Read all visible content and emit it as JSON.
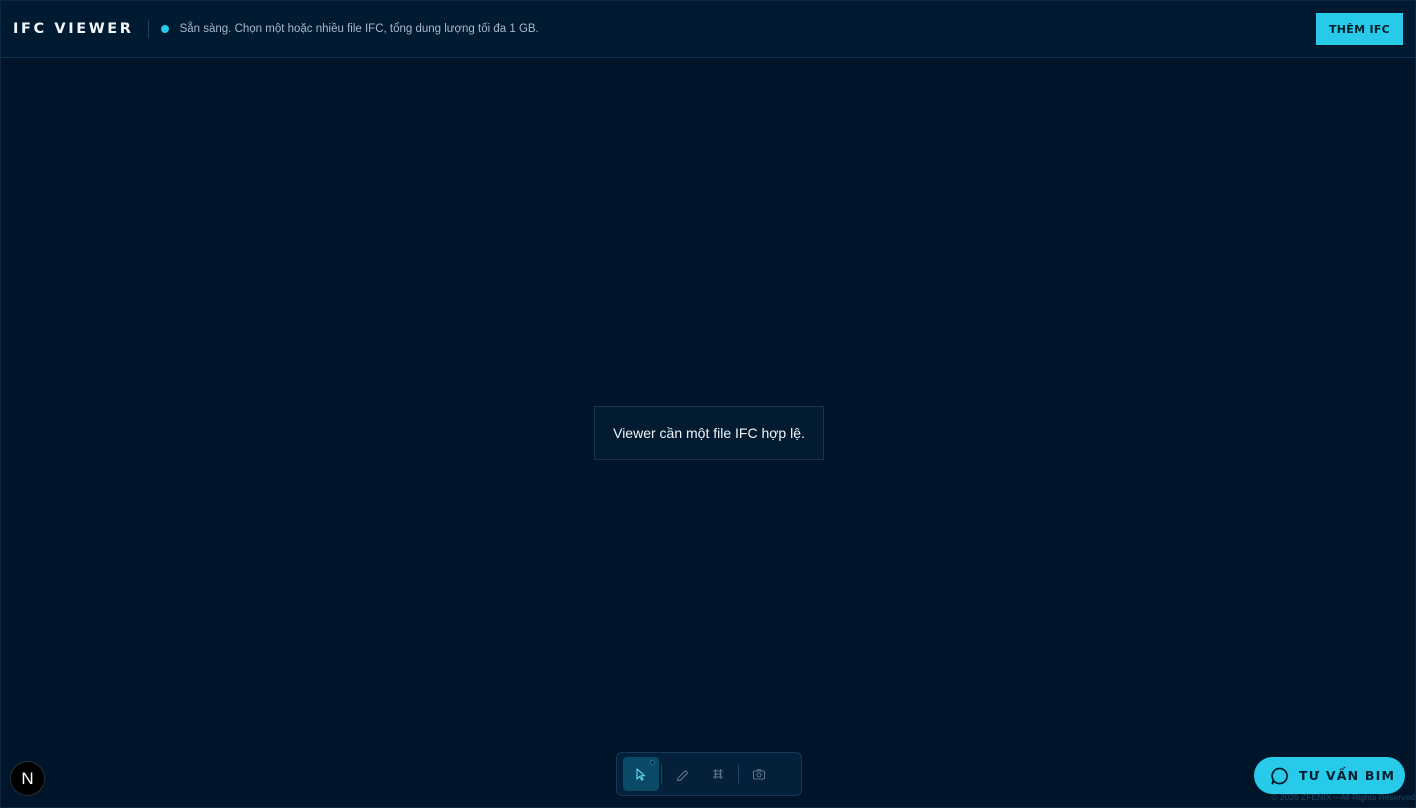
{
  "header": {
    "brand": "IFC VIEWER",
    "status_text": "Sẵn sàng. Chọn một hoặc nhiều file IFC, tổng dung lượng tối đa 1 GB.",
    "add_button_label": "THÊM IFC"
  },
  "viewer": {
    "empty_message": "Viewer cần một file IFC hợp lệ."
  },
  "toolbar": {
    "tools": [
      {
        "name": "select",
        "icon": "cursor-icon",
        "active": true
      },
      {
        "name": "measure",
        "icon": "ruler-icon",
        "active": false
      },
      {
        "name": "section",
        "icon": "section-plane-icon",
        "active": false
      },
      {
        "name": "screenshot",
        "icon": "camera-icon",
        "active": false
      }
    ]
  },
  "next_badge": {
    "label": "N"
  },
  "chat": {
    "label": "TƯ VẤN BIM",
    "icon": "chat-bubble-icon"
  },
  "footer": {
    "copyright": "© 2026 ZFENIX – All Rights Reserved"
  },
  "colors": {
    "background": "#00152a",
    "header_bg": "#001a31",
    "accent": "#27cbe9"
  }
}
